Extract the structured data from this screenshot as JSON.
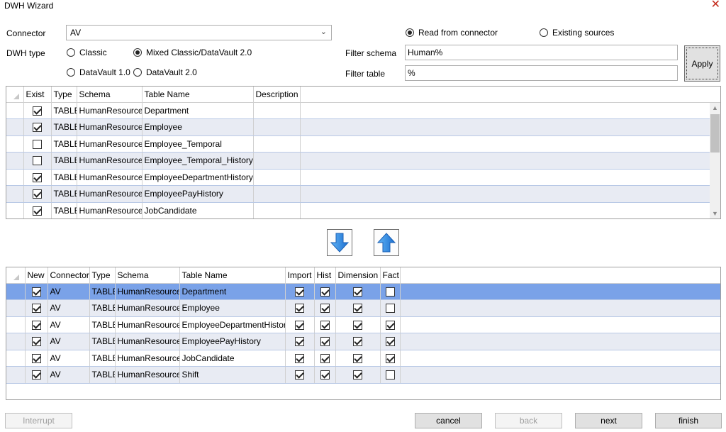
{
  "window": {
    "title": "DWH Wizard",
    "close_glyph": "✕"
  },
  "form": {
    "connector_label": "Connector",
    "connector_value": "AV",
    "dwh_type_label": "DWH type",
    "dwh_types": [
      {
        "label": "Classic",
        "selected": false
      },
      {
        "label": "Mixed Classic/DataVault 2.0",
        "selected": true
      },
      {
        "label": "DataVault 1.0",
        "selected": false
      },
      {
        "label": "DataVault 2.0",
        "selected": false
      }
    ],
    "source_options": [
      {
        "label": "Read from connector",
        "selected": true
      },
      {
        "label": "Existing sources",
        "selected": false
      }
    ],
    "filter_schema_label": "Filter schema",
    "filter_schema_value": "Human%",
    "filter_table_label": "Filter table",
    "filter_table_value": "%",
    "apply_label": "Apply"
  },
  "source_grid": {
    "columns": [
      "Exist",
      "Type",
      "Schema",
      "Table Name",
      "Description"
    ],
    "rows": [
      {
        "exist": true,
        "type": "TABLE",
        "schema": "HumanResources",
        "table": "Department",
        "description": ""
      },
      {
        "exist": true,
        "type": "TABLE",
        "schema": "HumanResources",
        "table": "Employee",
        "description": ""
      },
      {
        "exist": false,
        "type": "TABLE",
        "schema": "HumanResources",
        "table": "Employee_Temporal",
        "description": ""
      },
      {
        "exist": false,
        "type": "TABLE",
        "schema": "HumanResources",
        "table": "Employee_Temporal_History",
        "description": ""
      },
      {
        "exist": true,
        "type": "TABLE",
        "schema": "HumanResources",
        "table": "EmployeeDepartmentHistory",
        "description": ""
      },
      {
        "exist": true,
        "type": "TABLE",
        "schema": "HumanResources",
        "table": "EmployeePayHistory",
        "description": ""
      },
      {
        "exist": true,
        "type": "TABLE",
        "schema": "HumanResources",
        "table": "JobCandidate",
        "description": ""
      }
    ]
  },
  "move_buttons": {
    "down_icon": "arrow-down-icon",
    "up_icon": "arrow-up-icon",
    "accent": "#2e8ee6"
  },
  "target_grid": {
    "columns": [
      "New",
      "Connector",
      "Type",
      "Schema",
      "Table Name",
      "Import",
      "Hist",
      "Dimension",
      "Fact"
    ],
    "rows": [
      {
        "new": true,
        "connector": "AV",
        "type": "TABLE",
        "schema": "HumanResources",
        "table": "Department",
        "import": true,
        "hist": true,
        "dimension": true,
        "fact": false,
        "selected": true
      },
      {
        "new": true,
        "connector": "AV",
        "type": "TABLE",
        "schema": "HumanResources",
        "table": "Employee",
        "import": true,
        "hist": true,
        "dimension": true,
        "fact": false,
        "selected": false
      },
      {
        "new": true,
        "connector": "AV",
        "type": "TABLE",
        "schema": "HumanResources",
        "table": "EmployeeDepartmentHistory",
        "import": true,
        "hist": true,
        "dimension": true,
        "fact": true,
        "selected": false
      },
      {
        "new": true,
        "connector": "AV",
        "type": "TABLE",
        "schema": "HumanResources",
        "table": "EmployeePayHistory",
        "import": true,
        "hist": true,
        "dimension": true,
        "fact": true,
        "selected": false
      },
      {
        "new": true,
        "connector": "AV",
        "type": "TABLE",
        "schema": "HumanResources",
        "table": "JobCandidate",
        "import": true,
        "hist": true,
        "dimension": true,
        "fact": true,
        "selected": false
      },
      {
        "new": true,
        "connector": "AV",
        "type": "TABLE",
        "schema": "HumanResources",
        "table": "Shift",
        "import": true,
        "hist": true,
        "dimension": true,
        "fact": false,
        "selected": false
      }
    ]
  },
  "footer": {
    "interrupt": "Interrupt",
    "cancel": "cancel",
    "back": "back",
    "next": "next",
    "finish": "finish"
  },
  "colors": {
    "selected_row": "#7aa2e8",
    "alt_row": "#e8ebf3",
    "close": "#c42b1c"
  }
}
